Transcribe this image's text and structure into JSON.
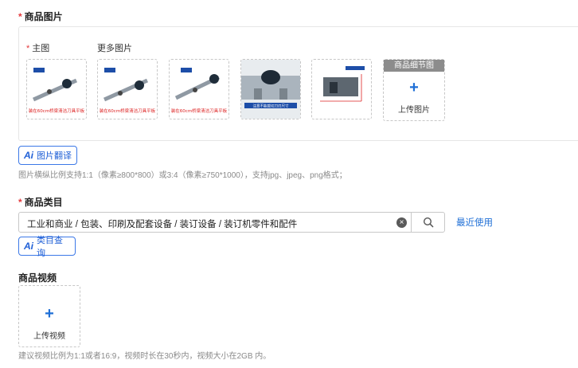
{
  "images_section": {
    "required_mark": "*",
    "title": "商品图片",
    "main_label": "主图",
    "more_label": "更多图片",
    "thumbnails": [
      {
        "caption": "装在60cm桥梁清洁刀具平板",
        "kind": "cutter"
      },
      {
        "caption": "装在60cm桥梁清洁刀具平板",
        "kind": "cutter"
      },
      {
        "caption": "装在60cm桥梁清洁刀具平板",
        "kind": "cutter"
      },
      {
        "caption": "注意不能裁切刀刃尺寸",
        "kind": "closeup"
      },
      {
        "caption": "",
        "kind": "dimension"
      }
    ],
    "detail_upload_header": "商品细节图",
    "detail_upload_plus": "+",
    "detail_upload_text": "上传图片",
    "ai_button_mark": "Ai",
    "ai_button_label": "图片翻译",
    "hint": "图片横纵比例支持1:1（像素≥800*800）或3:4（像素≥750*1000），支持jpg、jpeg、png格式；"
  },
  "category_section": {
    "required_mark": "*",
    "title": "商品类目",
    "value": "工业和商业 / 包装、印刷及配套设备 / 装订设备 / 装订机零件和配件",
    "clear_glyph": "×",
    "recent_link": "最近使用",
    "ai_button_mark": "Ai",
    "ai_button_label": "类目查询"
  },
  "video_section": {
    "title": "商品视频",
    "upload_plus": "+",
    "upload_text": "上传视频",
    "hint": "建议视频比例为1:1或者16:9，视频时长在30秒内，视频大小在2GB 内。"
  },
  "colors": {
    "accent": "#1f6fd6",
    "required": "#e4393c"
  }
}
